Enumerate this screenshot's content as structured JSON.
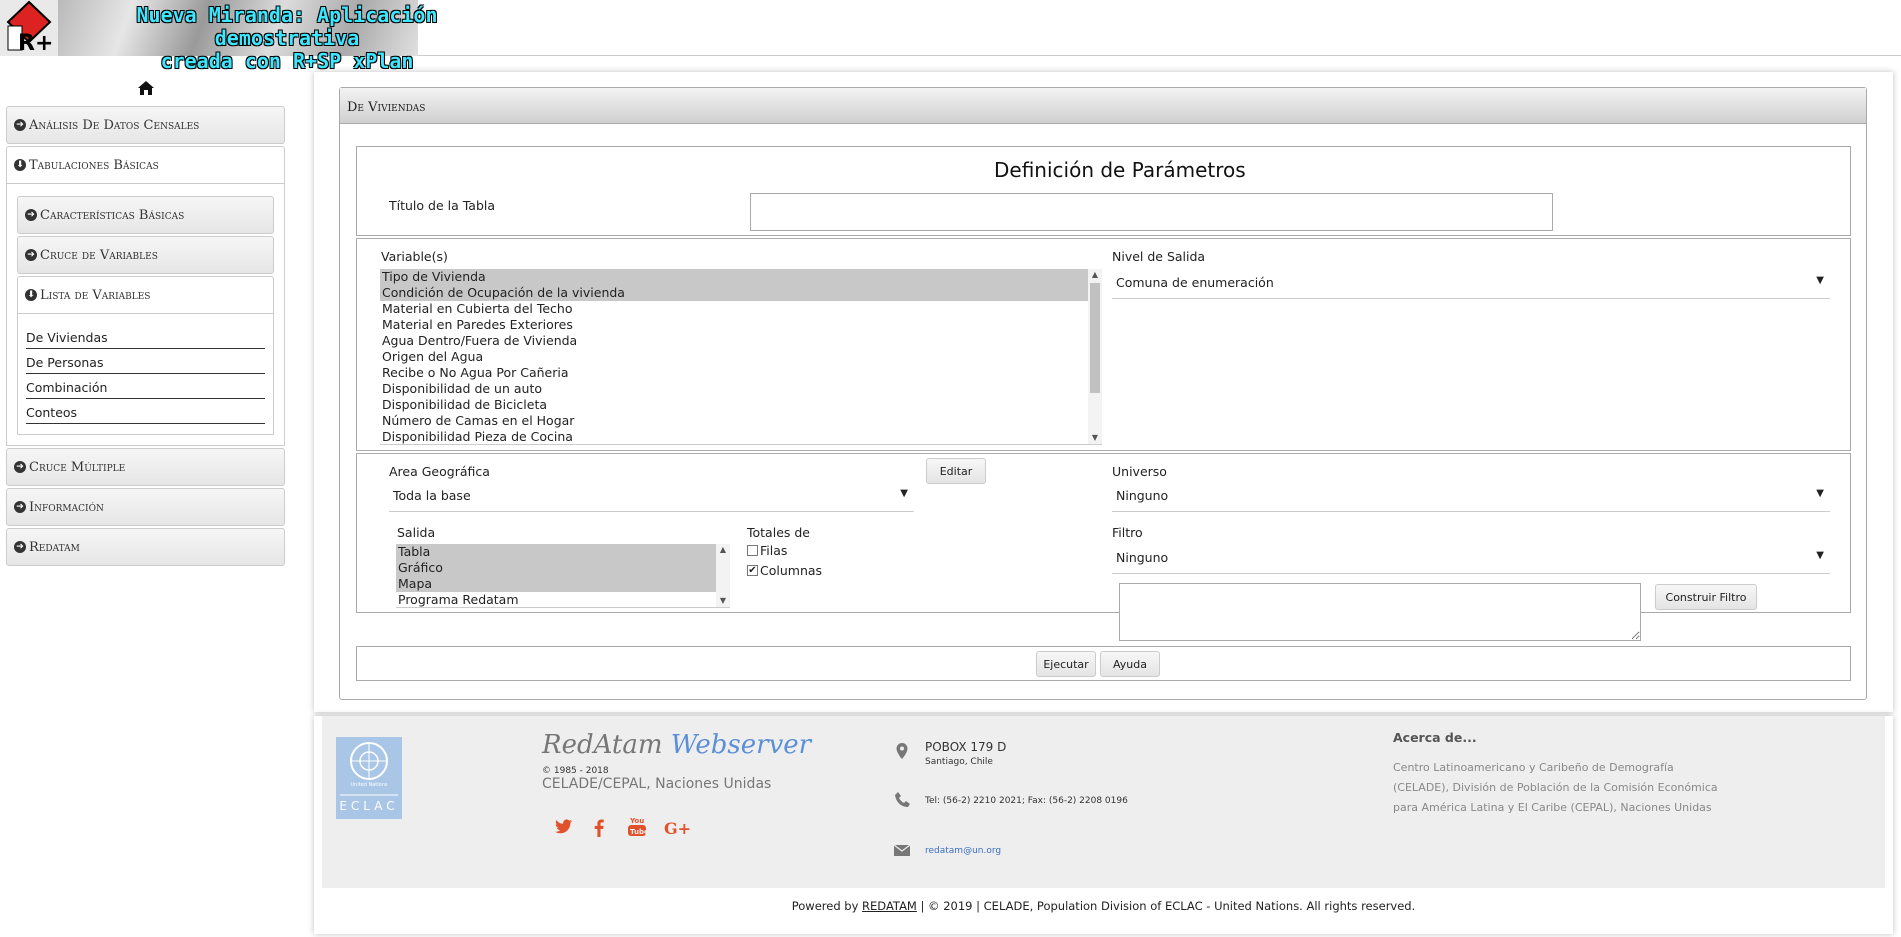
{
  "header": {
    "logo_text": "R+",
    "banner_line1": "Nueva Miranda: Aplicación demostrativa",
    "banner_line2": "creada con R+SP xPlan"
  },
  "sidebar": {
    "items": [
      {
        "label": "Análisis De Datos Censales"
      },
      {
        "label": "Tabulaciones Básicas"
      },
      {
        "label": "Cruce Múltiple"
      },
      {
        "label": "Información"
      },
      {
        "label": "Redatam"
      }
    ],
    "tab_basic": {
      "items": [
        {
          "label": "Características Básicas"
        },
        {
          "label": "Cruce de Variables"
        },
        {
          "label": "Lista de Variables"
        }
      ],
      "list_links": [
        "De Viviendas",
        "De Personas",
        "Combinación",
        "Conteos"
      ]
    }
  },
  "panel": {
    "title": "De Viviendas",
    "params_title": "Definición de Parámetros",
    "table_title_label": "Título de la Tabla",
    "table_title_value": "",
    "variables_label": "Variable(s)",
    "variables": [
      {
        "label": "Tipo de Vivienda",
        "selected": true
      },
      {
        "label": "Condición de Ocupación de la vivienda",
        "selected": true
      },
      {
        "label": "Material en Cubierta del Techo",
        "selected": false
      },
      {
        "label": "Material en Paredes Exteriores",
        "selected": false
      },
      {
        "label": "Agua Dentro/Fuera de Vivienda",
        "selected": false
      },
      {
        "label": "Origen del Agua",
        "selected": false
      },
      {
        "label": "Recibe o No Agua Por Cañeria",
        "selected": false
      },
      {
        "label": "Disponibilidad de un auto",
        "selected": false
      },
      {
        "label": "Disponibilidad de Bicicleta",
        "selected": false
      },
      {
        "label": "Número de Camas en el Hogar",
        "selected": false
      },
      {
        "label": "Disponibilidad Pieza de Cocina",
        "selected": false
      }
    ],
    "nivel_label": "Nivel de Salida",
    "nivel_value": "Comuna de enumeración",
    "area_label": "Area Geográfica",
    "area_value": "Toda la base",
    "editar_label": "Editar",
    "universo_label": "Universo",
    "universo_value": "Ninguno",
    "salida_label": "Salida",
    "salida_options": [
      {
        "label": "Tabla",
        "selected": true
      },
      {
        "label": "Gráfico",
        "selected": true
      },
      {
        "label": "Mapa",
        "selected": true
      },
      {
        "label": "Programa Redatam",
        "selected": false
      }
    ],
    "totales_label": "Totales de",
    "filas_label": "Filas",
    "filas_checked": false,
    "columnas_label": "Columnas",
    "columnas_checked": true,
    "filtro_label": "Filtro",
    "filtro_value": "Ninguno",
    "construir_label": "Construir Filtro",
    "ejecutar_label": "Ejecutar",
    "ayuda_label": "Ayuda"
  },
  "footer": {
    "un_line1": "United Nations",
    "un_line2": "ECLAC",
    "brand_red": "RedAtam",
    "brand_web": "Webserver",
    "years": "© 1985 - 2018",
    "org": "CELADE/CEPAL, Naciones Unidas",
    "address_line1": "POBOX 179 D",
    "address_line2": "Santiago, Chile",
    "phone": "Tel: (56-2) 2210 2021; Fax: (56-2) 2208 0196",
    "email": "redatam@un.org",
    "about_title": "Acerca de...",
    "about_text": "Centro Latinoamericano y Caribeño de Demografía (CELADE), División de Población de la Comisión Económica para América Latina y El Caribe (CEPAL), Naciones Unidas",
    "copyright_prefix": "Powered by",
    "copyright_link": "REDATAM",
    "copyright_suffix": "| © 2019 | CELADE, Population Division of ECLAC - United Nations. All rights reserved.",
    "social": [
      "twitter",
      "facebook",
      "youtube",
      "google-plus"
    ]
  },
  "colors": {
    "banner_text": "#3ee6ff",
    "social": "#e0522b",
    "brand_web": "#5b8fd6",
    "selected_option": "#c8c8c8"
  }
}
